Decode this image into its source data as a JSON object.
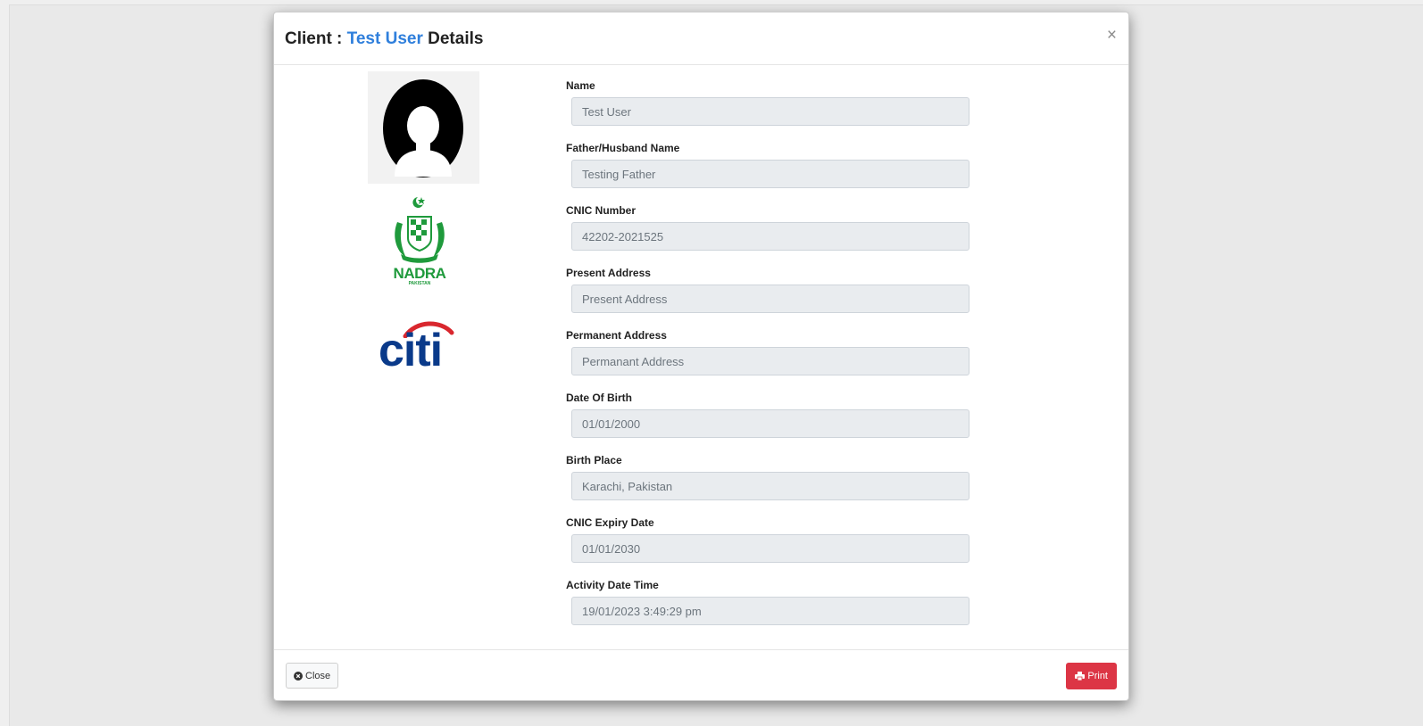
{
  "modal": {
    "title_prefix": "Client : ",
    "title_name": "Test User",
    "title_suffix": " Details",
    "close_symbol": "×",
    "accent_color": "#2f7fdc"
  },
  "images": {
    "avatar_icon": "user-avatar-icon",
    "nadra_logo": {
      "name": "nadra-logo",
      "text": "NADRA",
      "subtext": "PAKISTAN",
      "color": "#1f9a3c"
    },
    "citi_logo": {
      "name": "citi-logo",
      "text": "citi",
      "text_color": "#0a3a8a",
      "arc_color": "#d9272e"
    }
  },
  "fields": [
    {
      "label": "Name",
      "value": "Test User"
    },
    {
      "label": "Father/Husband Name",
      "value": "Testing Father"
    },
    {
      "label": "CNIC Number",
      "value": "42202-2021525"
    },
    {
      "label": "Present Address",
      "value": "Present Address"
    },
    {
      "label": "Permanent Address",
      "value": "Permanant Address"
    },
    {
      "label": "Date Of Birth",
      "value": "01/01/2000"
    },
    {
      "label": "Birth Place",
      "value": "Karachi, Pakistan"
    },
    {
      "label": "CNIC Expiry Date",
      "value": "01/01/2030"
    },
    {
      "label": "Activity Date Time",
      "value": "19/01/2023 3:49:29 pm"
    }
  ],
  "footer": {
    "close_label": "Close",
    "close_icon": "times-circle-icon",
    "print_label": "Print",
    "print_icon": "printer-icon",
    "print_color": "#dc3545"
  }
}
